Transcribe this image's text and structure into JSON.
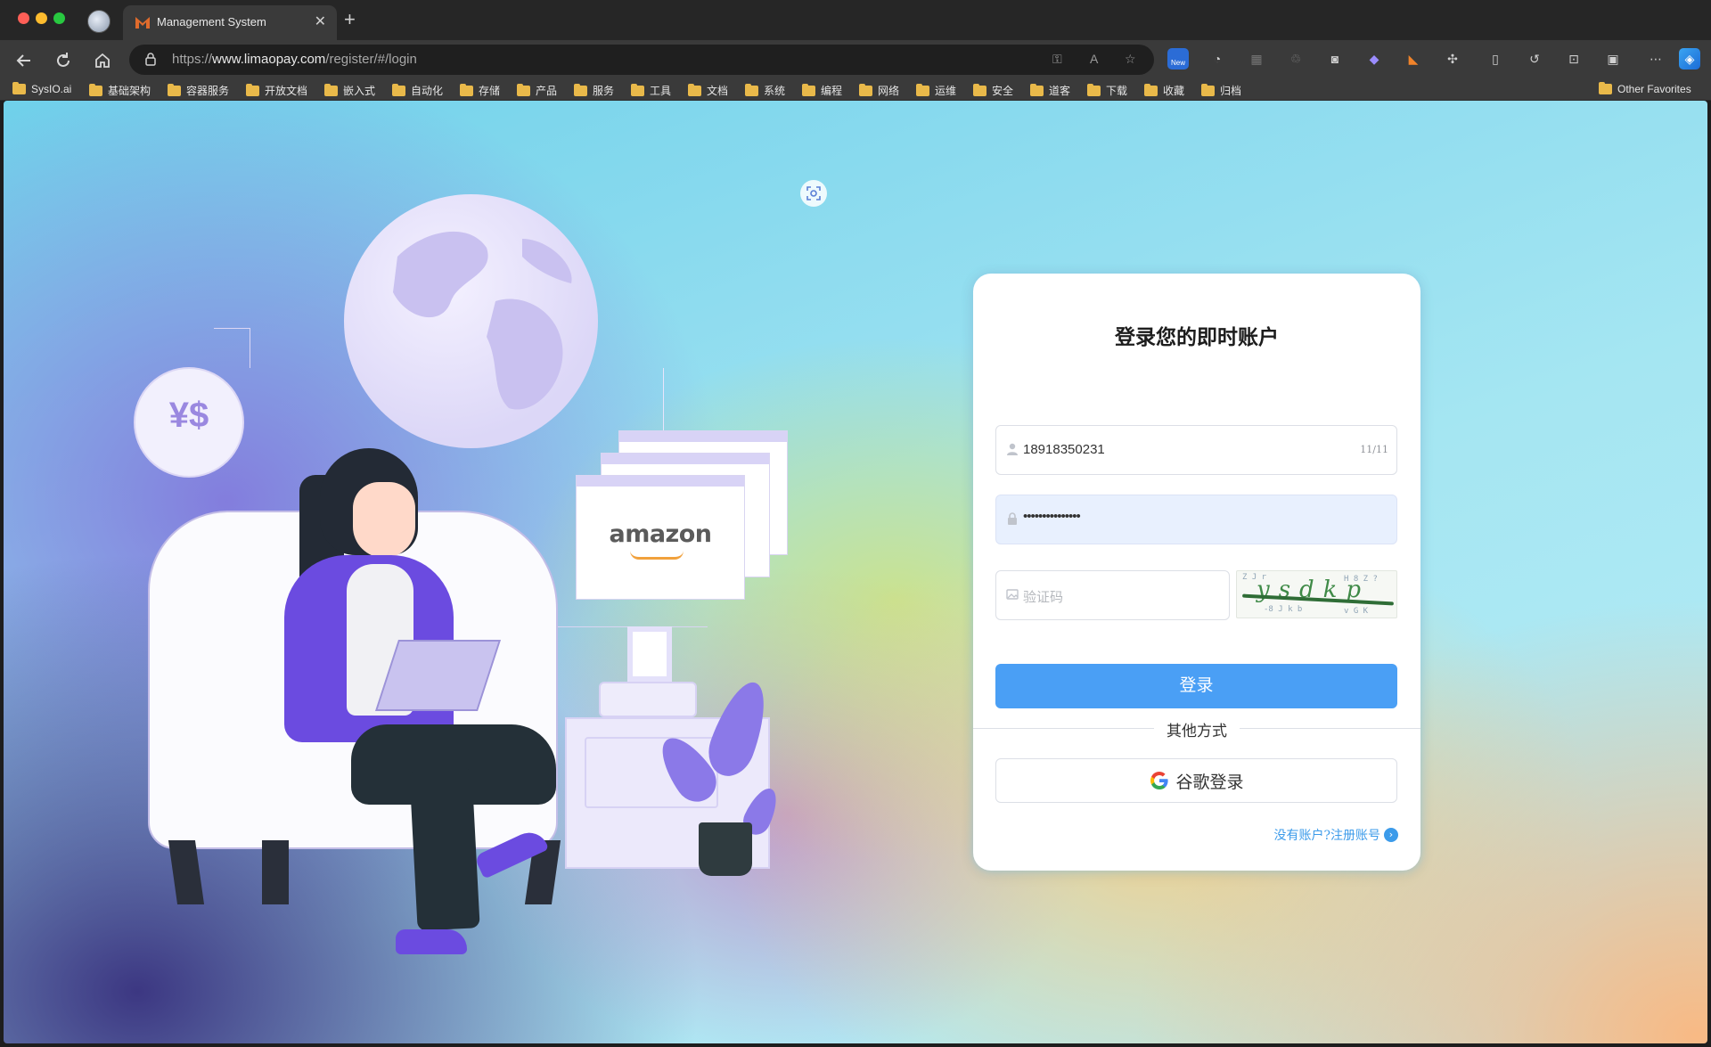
{
  "browser": {
    "tab_title": "Management System",
    "new_tab_label": "+",
    "tab_close_label": "✕",
    "url_prefix": "https://",
    "url_domain": "www.limaopay.com",
    "url_path": "/register/#/login",
    "extension_badge": "New",
    "bookmarks": [
      "SysIO.ai",
      "基础架构",
      "容器服务",
      "开放文档",
      "嵌入式",
      "自动化",
      "存储",
      "产品",
      "服务",
      "工具",
      "文档",
      "系统",
      "编程",
      "网络",
      "运维",
      "安全",
      "道客",
      "下载",
      "收藏",
      "归档"
    ],
    "other_favorites": "Other Favorites"
  },
  "illustration": {
    "brand_text": "amazon",
    "currency_text": "¥$"
  },
  "login": {
    "title": "登录您的即时账户",
    "phone_value": "18918350231",
    "phone_count": "11/11",
    "password_value": "•••••••••••••••",
    "captcha_placeholder": "验证码",
    "captcha_text": "ysdkp",
    "login_button": "登录",
    "other_methods": "其他方式",
    "google_button": "谷歌登录",
    "register_link": "没有账户?注册账号",
    "register_arrow": "›"
  },
  "colors": {
    "primary": "#4a9ff5",
    "link": "#3c9bea",
    "autofill_bg": "#e8f0fe"
  }
}
